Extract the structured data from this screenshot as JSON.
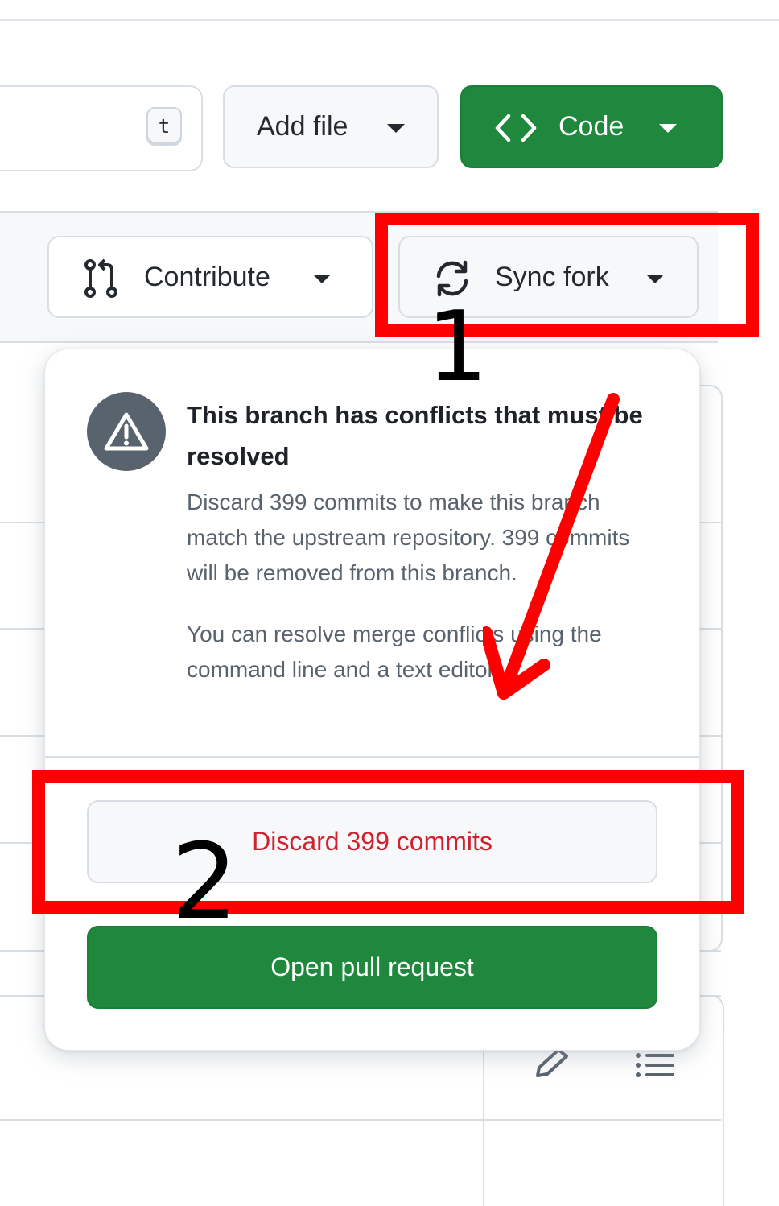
{
  "toolbar": {
    "shortcut_key": "t",
    "add_file_label": "Add file",
    "code_label": "Code"
  },
  "fork_bar": {
    "contribute_label": "Contribute",
    "sync_fork_label": "Sync fork"
  },
  "popover": {
    "title": "This branch has conflicts that must be resolved",
    "description": "Discard 399 commits to make this branch match the upstream repository. 399 commits will be removed from this branch.",
    "hint": "You can resolve merge conflicts using the command line and a text editor.",
    "discard_label": "Discard 399 commits",
    "open_pr_label": "Open pull request"
  },
  "annotations": {
    "step1": "1",
    "step2": "2",
    "color": "#ff0000"
  },
  "colors": {
    "primary_green": "#1f883d",
    "danger_red": "#cf222e",
    "muted_text": "#59636e"
  },
  "icons": [
    "triangle-down-icon",
    "code-icon",
    "git-pull-request-icon",
    "sync-icon",
    "alert-icon",
    "pencil-icon",
    "list-unordered-icon"
  ]
}
